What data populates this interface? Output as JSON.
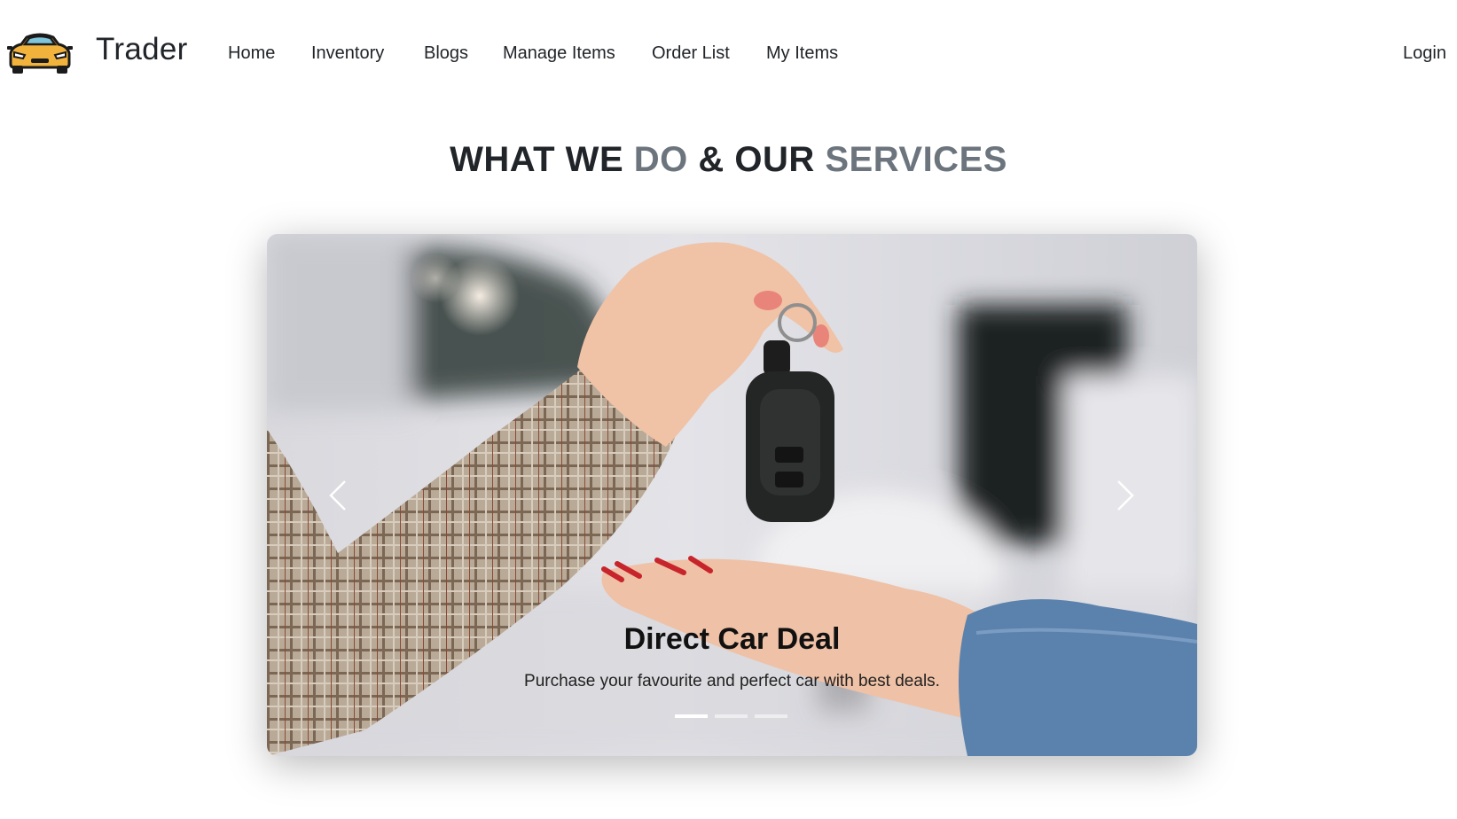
{
  "brand": {
    "name": "Trader",
    "logo_icon": "sports-car-icon"
  },
  "nav": {
    "home": "Home",
    "inventory": "Inventory",
    "blogs": "Blogs",
    "manage_items": "Manage Items",
    "order_list": "Order List",
    "my_items": "My Items",
    "login": "Login"
  },
  "section": {
    "title_part1": "WHAT WE ",
    "title_part2": "DO",
    "title_part3": " & OUR ",
    "title_part4": "SERVICES"
  },
  "carousel": {
    "slide_title": "Direct Car Deal",
    "slide_text": "Purchase your favourite and perfect car with best deals.",
    "prev_icon": "chevron-left-icon",
    "next_icon": "chevron-right-icon",
    "indicator_count": 3,
    "active_index": 0
  },
  "colors": {
    "text_dark": "#212529",
    "text_muted": "#6c757d",
    "logo_yellow": "#f2b33d"
  }
}
